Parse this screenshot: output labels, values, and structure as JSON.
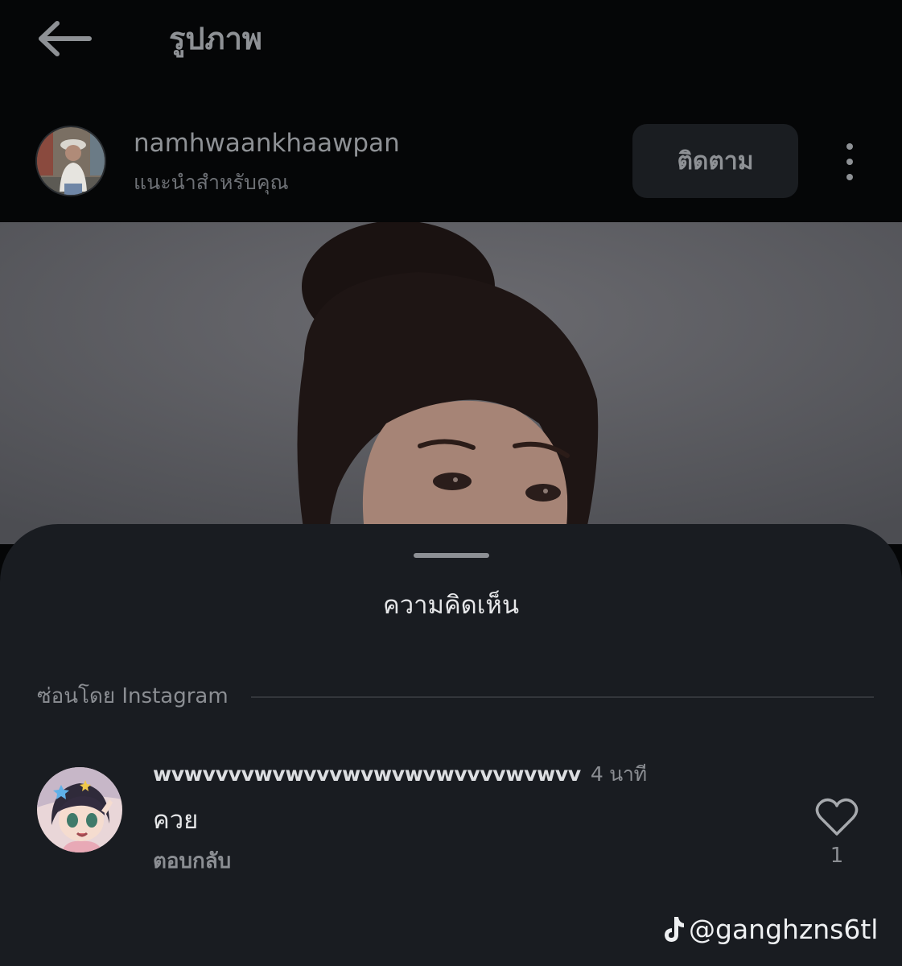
{
  "header": {
    "back_icon": "arrow-left-icon",
    "title": "รูปภาพ"
  },
  "post": {
    "username": "namhwaankhaawpan",
    "subtitle": "แนะนำสำหรับคุณ",
    "follow_label": "ติดตาม",
    "more_icon": "more-vertical-icon"
  },
  "comments_sheet": {
    "title": "ความคิดเห็น",
    "hidden_label": "ซ่อนโดย Instagram",
    "comment": {
      "username": "wvwvvvvwvwvvvwvwvwvwvvvvwvwvv",
      "time": "4 นาที",
      "text": "ควย",
      "reply_label": "ตอบกลับ",
      "like_icon": "heart-outline-icon",
      "like_count": "1"
    }
  },
  "watermark": {
    "icon": "tiktok-logo-icon",
    "text": "@ganghzns6tl"
  },
  "colors": {
    "background": "#050607",
    "sheet": "#191c21",
    "button_bg": "#1a1d21",
    "muted_text": "#8b8e93",
    "primary_text": "#e6e7e9"
  }
}
